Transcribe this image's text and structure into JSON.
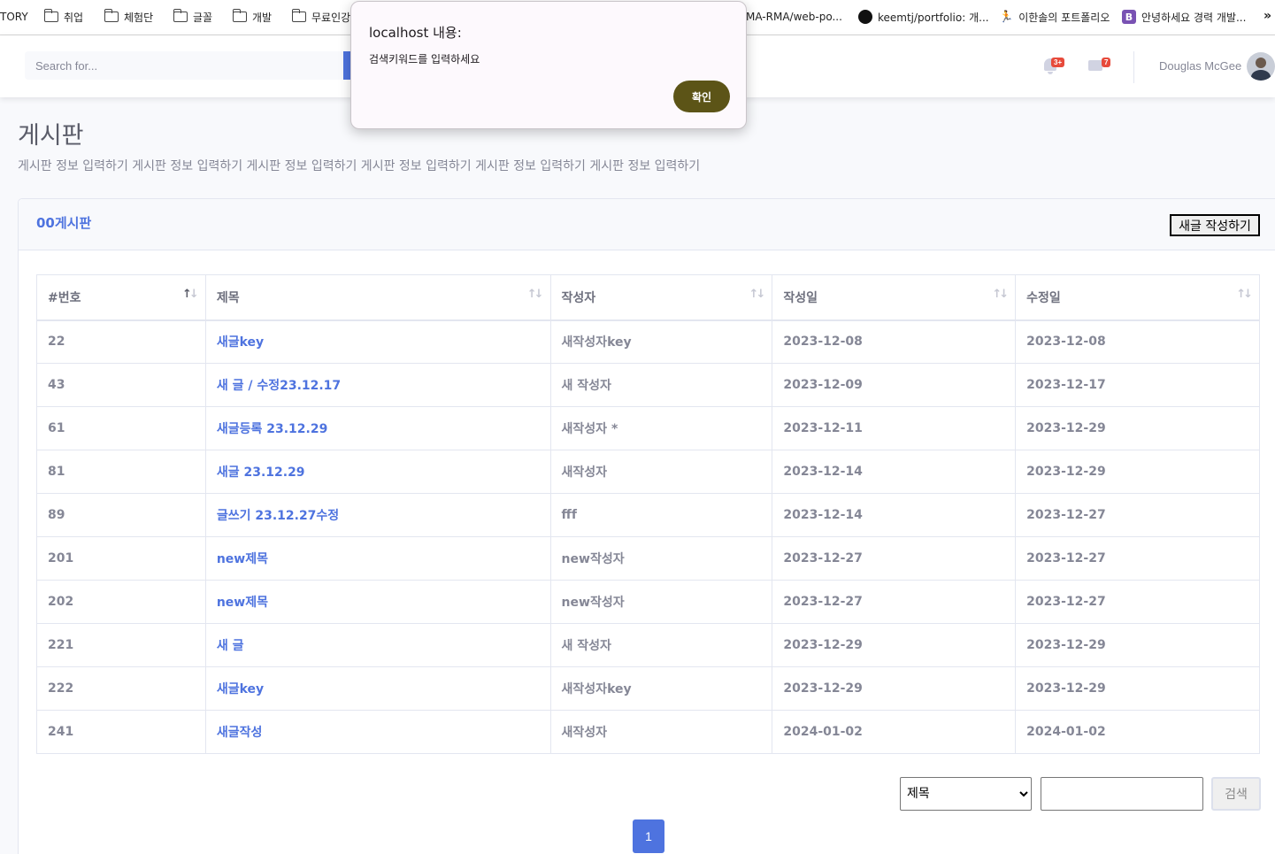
{
  "bookmarks": {
    "items": [
      {
        "label": "TORY",
        "icon": "none"
      },
      {
        "label": "취업",
        "icon": "folder-icon"
      },
      {
        "label": "체험단",
        "icon": "folder-icon"
      },
      {
        "label": "글꼴",
        "icon": "folder-icon"
      },
      {
        "label": "개발",
        "icon": "folder-icon"
      },
      {
        "label": "무료인강",
        "icon": "folder-icon"
      },
      {
        "label": "MA-RMA/web-po...",
        "icon": "none"
      },
      {
        "label": "keemtj/portfolio: 개...",
        "icon": "github-icon"
      },
      {
        "label": "이한솔의 포트폴리오",
        "icon": "runner-icon"
      },
      {
        "label": "안녕하세요 경력 개발...",
        "icon": "bootstrap-icon"
      }
    ],
    "more": "»"
  },
  "topbar": {
    "search_placeholder": "Search for...",
    "alerts_badge": "3+",
    "messages_badge": "7",
    "user_name": "Douglas McGee"
  },
  "page": {
    "title": "게시판",
    "description": "게시판 정보 입력하기 게시판 정보 입력하기 게시판 정보 입력하기 게시판 정보 입력하기 게시판 정보 입력하기 게시판 정보 입력하기"
  },
  "card": {
    "title": "00게시판",
    "write_button": "새글 작성하기"
  },
  "table": {
    "headers": [
      "#번호",
      "제목",
      "작성자",
      "작성일",
      "수정일"
    ],
    "rows": [
      {
        "no": "22",
        "title": "새글key",
        "author": "새작성자key",
        "created": "2023-12-08",
        "modified": "2023-12-08"
      },
      {
        "no": "43",
        "title": "새 글 / 수정23.12.17",
        "author": "새 작성자",
        "created": "2023-12-09",
        "modified": "2023-12-17"
      },
      {
        "no": "61",
        "title": "새글등록 23.12.29",
        "author": "새작성자 *",
        "created": "2023-12-11",
        "modified": "2023-12-29"
      },
      {
        "no": "81",
        "title": "새글 23.12.29",
        "author": "새작성자",
        "created": "2023-12-14",
        "modified": "2023-12-29"
      },
      {
        "no": "89",
        "title": "글쓰기 23.12.27수정",
        "author": "fff",
        "created": "2023-12-14",
        "modified": "2023-12-27"
      },
      {
        "no": "201",
        "title": "new제목",
        "author": "new작성자",
        "created": "2023-12-27",
        "modified": "2023-12-27"
      },
      {
        "no": "202",
        "title": "new제목",
        "author": "new작성자",
        "created": "2023-12-27",
        "modified": "2023-12-27"
      },
      {
        "no": "221",
        "title": "새 글",
        "author": "새 작성자",
        "created": "2023-12-29",
        "modified": "2023-12-29"
      },
      {
        "no": "222",
        "title": "새글key",
        "author": "새작성자key",
        "created": "2023-12-29",
        "modified": "2023-12-29"
      },
      {
        "no": "241",
        "title": "새글작성",
        "author": "새작성자",
        "created": "2024-01-02",
        "modified": "2024-01-02"
      }
    ]
  },
  "search_bar": {
    "select_value": "제목",
    "select_options": [
      "제목"
    ],
    "input_value": "",
    "submit_label": "검색"
  },
  "pagination": {
    "current_page": "1"
  },
  "dialog": {
    "title": "localhost 내용:",
    "message": "검색키워드를 입력하세요",
    "ok_label": "확인"
  },
  "colors": {
    "primary": "#4e73df",
    "badge_red": "#e74a3b",
    "dialog_button": "#5c5417",
    "text_muted": "#858796"
  }
}
